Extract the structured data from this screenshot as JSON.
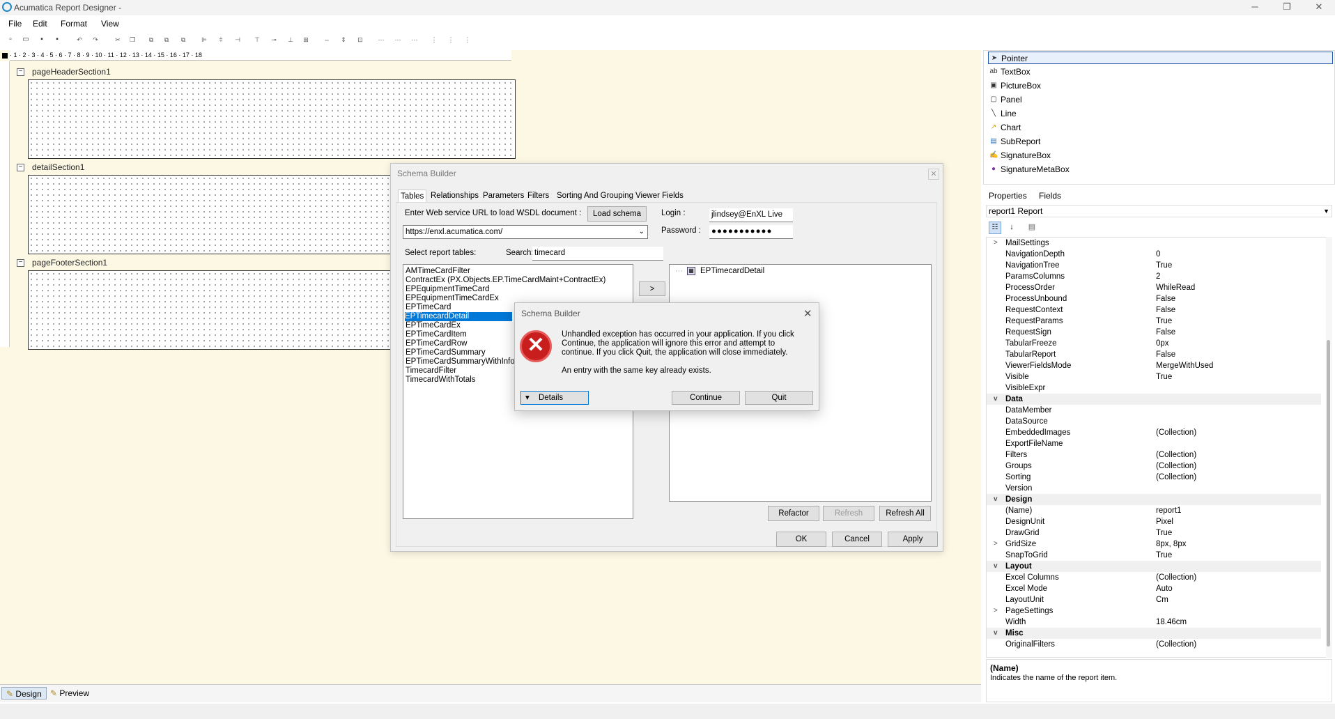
{
  "window": {
    "title": "Acumatica Report Designer -",
    "minimize": "─",
    "maximize": "❐",
    "close": "✕"
  },
  "menu": [
    "File",
    "Edit",
    "Format",
    "View"
  ],
  "ruler": {
    "marks": "· 1 · 2 · 3 · 4 · 5 · 6 · 7 · 8 · 9 · 10 · 11 · 12 · 13 · 14 · 15 · 16 · 17 · 18"
  },
  "sections": [
    {
      "label": "pageHeaderSection1",
      "toggle": "−"
    },
    {
      "label": "detailSection1",
      "toggle": "−"
    },
    {
      "label": "pageFooterSection1",
      "toggle": "−"
    }
  ],
  "bottom_tabs": [
    "Design",
    "Preview"
  ],
  "toolbox": {
    "items": [
      "Pointer",
      "TextBox",
      "PictureBox",
      "Panel",
      "Line",
      "Chart",
      "SubReport",
      "SignatureBox",
      "SignatureMetaBox"
    ],
    "selected": "Pointer"
  },
  "properties": {
    "tabs": [
      "Properties",
      "Fields"
    ],
    "object": "report1 Report",
    "rows": [
      {
        "name": "MailSettings",
        "value": "",
        "expand": ">"
      },
      {
        "name": "NavigationDepth",
        "value": "0"
      },
      {
        "name": "NavigationTree",
        "value": "True"
      },
      {
        "name": "ParamsColumns",
        "value": "2"
      },
      {
        "name": "ProcessOrder",
        "value": "WhileRead"
      },
      {
        "name": "ProcessUnbound",
        "value": "False"
      },
      {
        "name": "RequestContext",
        "value": "False"
      },
      {
        "name": "RequestParams",
        "value": "True"
      },
      {
        "name": "RequestSign",
        "value": "False"
      },
      {
        "name": "TabularFreeze",
        "value": "0px"
      },
      {
        "name": "TabularReport",
        "value": "False"
      },
      {
        "name": "ViewerFieldsMode",
        "value": "MergeWithUsed"
      },
      {
        "name": "Visible",
        "value": "True"
      },
      {
        "name": "VisibleExpr",
        "value": ""
      },
      {
        "name": "Data",
        "value": "",
        "category": true,
        "expand": "v"
      },
      {
        "name": "DataMember",
        "value": ""
      },
      {
        "name": "DataSource",
        "value": ""
      },
      {
        "name": "EmbeddedImages",
        "value": "(Collection)"
      },
      {
        "name": "ExportFileName",
        "value": ""
      },
      {
        "name": "Filters",
        "value": "(Collection)"
      },
      {
        "name": "Groups",
        "value": "(Collection)"
      },
      {
        "name": "Sorting",
        "value": "(Collection)"
      },
      {
        "name": "Version",
        "value": ""
      },
      {
        "name": "Design",
        "value": "",
        "category": true,
        "expand": "v"
      },
      {
        "name": "(Name)",
        "value": "report1"
      },
      {
        "name": "DesignUnit",
        "value": "Pixel"
      },
      {
        "name": "DrawGrid",
        "value": "True"
      },
      {
        "name": "GridSize",
        "value": "8px, 8px",
        "expand": ">"
      },
      {
        "name": "SnapToGrid",
        "value": "True"
      },
      {
        "name": "Layout",
        "value": "",
        "category": true,
        "expand": "v"
      },
      {
        "name": "Excel Columns",
        "value": "(Collection)"
      },
      {
        "name": "Excel Mode",
        "value": "Auto"
      },
      {
        "name": "LayoutUnit",
        "value": "Cm"
      },
      {
        "name": "PageSettings",
        "value": "",
        "expand": ">"
      },
      {
        "name": "Width",
        "value": "18.46cm"
      },
      {
        "name": "Misc",
        "value": "",
        "category": true,
        "expand": "v"
      },
      {
        "name": "OriginalFilters",
        "value": "(Collection)"
      }
    ],
    "description": {
      "title": "(Name)",
      "text": "Indicates the name of the report item."
    }
  },
  "schema_builder": {
    "title": "Schema Builder",
    "close": "✕",
    "tabs": [
      "Tables",
      "Relationships",
      "Parameters",
      "Filters",
      "Sorting And Grouping",
      "Viewer Fields"
    ],
    "wsdl_label": "Enter Web service URL to load WSDL document :",
    "load_button": "Load schema",
    "url": "https://enxl.acumatica.com/",
    "login_label": "Login :",
    "login_value": "jlindsey@EnXL Live",
    "password_label": "Password :",
    "password_value": "●●●●●●●●●●●",
    "select_label": "Select report tables:",
    "search_label": "Search:",
    "search_value": "timecard",
    "tables": [
      "AMTimeCardFilter",
      "ContractEx (PX.Objects.EP.TimeCardMaint+ContractEx)",
      "EPEquipmentTimeCard",
      "EPEquipmentTimeCardEx",
      "EPTimeCard",
      "EPTimecardDetail",
      "EPTimeCardEx",
      "EPTimeCardItem",
      "EPTimeCardRow",
      "EPTimeCardSummary",
      "EPTimeCardSummaryWithInfo",
      "TimecardFilter",
      "TimecardWithTotals"
    ],
    "selected_table": "EPTimecardDetail",
    "move_button": ">",
    "selected_tree": [
      "EPTimecardDetail"
    ],
    "refactor": "Refactor",
    "refresh": "Refresh",
    "refresh_all": "Refresh All",
    "ok": "OK",
    "cancel": "Cancel",
    "apply": "Apply"
  },
  "error_dialog": {
    "title": "Schema Builder",
    "close": "✕",
    "icon": "✕",
    "message": "Unhandled exception has occurred in your application. If you click Continue, the application will ignore this error and attempt to continue. If you click Quit, the application will close immediately.",
    "detail": "An entry with the same key already exists.",
    "details_button": "Details",
    "details_arrow": "▾",
    "continue_button": "Continue",
    "quit_button": "Quit"
  }
}
